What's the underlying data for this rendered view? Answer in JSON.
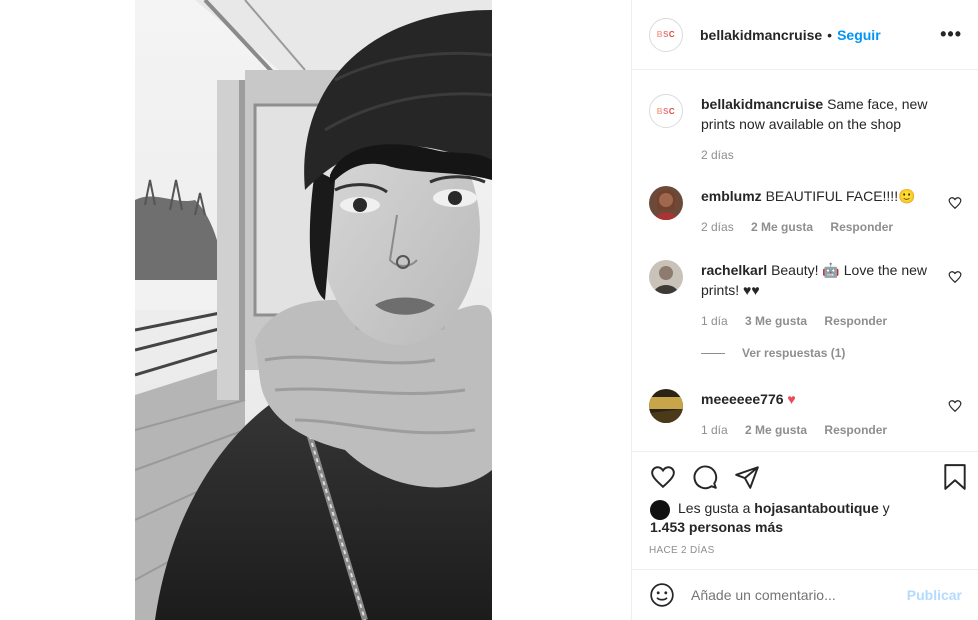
{
  "header": {
    "avatar_logo": {
      "l1": "B",
      "l2": "S",
      "l3": "C"
    },
    "username": "bellakidmancruise",
    "separator": "•",
    "follow_label": "Seguir",
    "more_label": "•••"
  },
  "caption": {
    "username": "bellakidmancruise",
    "text": "Same face, new prints now available on the shop",
    "time": "2 días"
  },
  "comments": [
    {
      "username": "emblumz",
      "text": "BEAUTIFUL FACE!!!!🙂",
      "time": "2 días",
      "likes": "2 Me gusta",
      "reply": "Responder"
    },
    {
      "username": "rachelkarl",
      "text": "Beauty! 🤖 Love the new prints! ♥♥",
      "time": "1 día",
      "likes": "3 Me gusta",
      "reply": "Responder"
    },
    {
      "username": "meeeeee776",
      "text": "♥",
      "time": "1 día",
      "likes": "2 Me gusta",
      "reply": "Responder"
    }
  ],
  "view_replies": "Ver respuestas (1)",
  "actions": {
    "icons": [
      "heart-icon",
      "comment-icon",
      "share-icon",
      "bookmark-icon"
    ]
  },
  "likes": {
    "prefix": "Les gusta a",
    "user": "hojasantaboutique",
    "joiner": "y",
    "others": "1.453 personas más"
  },
  "posted": "HACE 2 DÍAS",
  "composer": {
    "placeholder": "Añade un comentario...",
    "publish_label": "Publicar"
  },
  "colors": {
    "accent": "#0095f6",
    "publish_disabled": "#b3dbff",
    "muted": "#8e8e8e",
    "text": "#262626",
    "heart_red": "#ed4956"
  }
}
